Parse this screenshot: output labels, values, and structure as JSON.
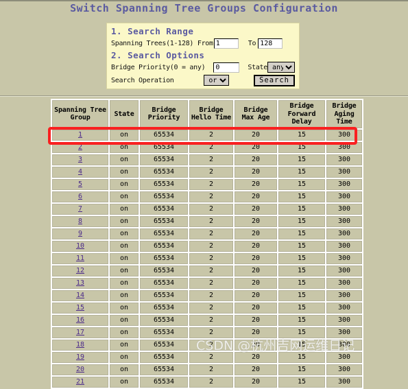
{
  "page": {
    "title": "Switch Spanning Tree Groups Configuration",
    "title_color": "#5a5aa0",
    "background_color": "#c8c6a8",
    "panel_color": "#fbf8c8",
    "highlight_color": "#f92020"
  },
  "search_panel": {
    "range_section": {
      "heading": "1.  Search Range",
      "label": "Spanning Trees(1-128) From",
      "from_value": "1",
      "to_label": "To",
      "to_value": "128"
    },
    "options_section": {
      "heading": "2.  Search Options",
      "priority_label": "Bridge Priority(0 = any)",
      "priority_value": "0",
      "state_label": "State",
      "state_value": "any",
      "state_options": [
        "any"
      ],
      "operation_label": "Search Operation",
      "operation_value": "or",
      "operation_options": [
        "or"
      ],
      "search_button": "Search"
    }
  },
  "results": {
    "columns": [
      "Spanning Tree Group",
      "State",
      "Bridge Priority",
      "Bridge Hello Time",
      "Bridge Max Age",
      "Bridge Forward Delay",
      "Bridge Aging Time"
    ],
    "rows": [
      {
        "group": "1",
        "state": "on",
        "priority": "65534",
        "hello": "2",
        "max_age": "20",
        "forward_delay": "15",
        "aging_time": "300"
      },
      {
        "group": "2",
        "state": "on",
        "priority": "65534",
        "hello": "2",
        "max_age": "20",
        "forward_delay": "15",
        "aging_time": "300"
      },
      {
        "group": "3",
        "state": "on",
        "priority": "65534",
        "hello": "2",
        "max_age": "20",
        "forward_delay": "15",
        "aging_time": "300"
      },
      {
        "group": "4",
        "state": "on",
        "priority": "65534",
        "hello": "2",
        "max_age": "20",
        "forward_delay": "15",
        "aging_time": "300"
      },
      {
        "group": "5",
        "state": "on",
        "priority": "65534",
        "hello": "2",
        "max_age": "20",
        "forward_delay": "15",
        "aging_time": "300"
      },
      {
        "group": "6",
        "state": "on",
        "priority": "65534",
        "hello": "2",
        "max_age": "20",
        "forward_delay": "15",
        "aging_time": "300"
      },
      {
        "group": "7",
        "state": "on",
        "priority": "65534",
        "hello": "2",
        "max_age": "20",
        "forward_delay": "15",
        "aging_time": "300"
      },
      {
        "group": "8",
        "state": "on",
        "priority": "65534",
        "hello": "2",
        "max_age": "20",
        "forward_delay": "15",
        "aging_time": "300"
      },
      {
        "group": "9",
        "state": "on",
        "priority": "65534",
        "hello": "2",
        "max_age": "20",
        "forward_delay": "15",
        "aging_time": "300"
      },
      {
        "group": "10",
        "state": "on",
        "priority": "65534",
        "hello": "2",
        "max_age": "20",
        "forward_delay": "15",
        "aging_time": "300"
      },
      {
        "group": "11",
        "state": "on",
        "priority": "65534",
        "hello": "2",
        "max_age": "20",
        "forward_delay": "15",
        "aging_time": "300"
      },
      {
        "group": "12",
        "state": "on",
        "priority": "65534",
        "hello": "2",
        "max_age": "20",
        "forward_delay": "15",
        "aging_time": "300"
      },
      {
        "group": "13",
        "state": "on",
        "priority": "65534",
        "hello": "2",
        "max_age": "20",
        "forward_delay": "15",
        "aging_time": "300"
      },
      {
        "group": "14",
        "state": "on",
        "priority": "65534",
        "hello": "2",
        "max_age": "20",
        "forward_delay": "15",
        "aging_time": "300"
      },
      {
        "group": "15",
        "state": "on",
        "priority": "65534",
        "hello": "2",
        "max_age": "20",
        "forward_delay": "15",
        "aging_time": "300"
      },
      {
        "group": "16",
        "state": "on",
        "priority": "65534",
        "hello": "2",
        "max_age": "20",
        "forward_delay": "15",
        "aging_time": "300"
      },
      {
        "group": "17",
        "state": "on",
        "priority": "65534",
        "hello": "2",
        "max_age": "20",
        "forward_delay": "15",
        "aging_time": "300"
      },
      {
        "group": "18",
        "state": "on",
        "priority": "65534",
        "hello": "2",
        "max_age": "20",
        "forward_delay": "15",
        "aging_time": "300"
      },
      {
        "group": "19",
        "state": "on",
        "priority": "65534",
        "hello": "2",
        "max_age": "20",
        "forward_delay": "15",
        "aging_time": "300"
      },
      {
        "group": "20",
        "state": "on",
        "priority": "65534",
        "hello": "2",
        "max_age": "20",
        "forward_delay": "15",
        "aging_time": "300"
      },
      {
        "group": "21",
        "state": "on",
        "priority": "65534",
        "hello": "2",
        "max_age": "20",
        "forward_delay": "15",
        "aging_time": "300"
      }
    ],
    "highlighted_row_index": 0
  },
  "watermark": {
    "text": "CSDN @杭州吉网运维日记"
  }
}
